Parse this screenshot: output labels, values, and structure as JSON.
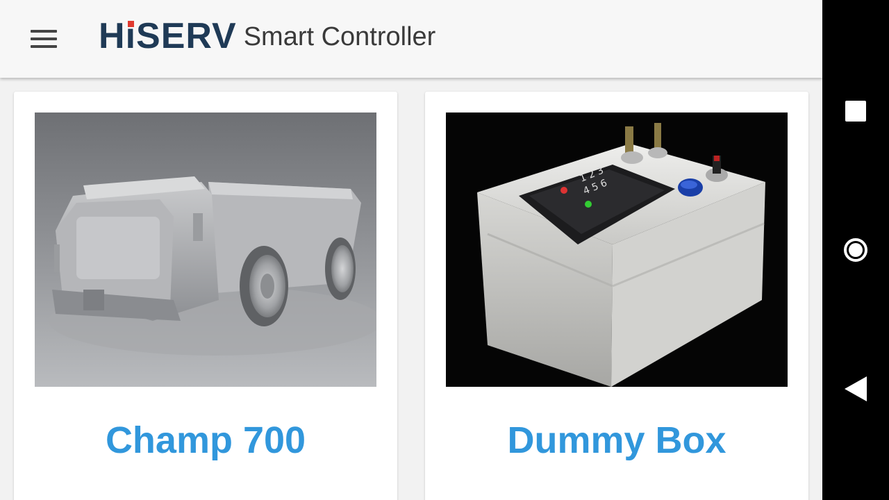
{
  "header": {
    "logo_text": "HiSERV",
    "logo_letter_h": "H",
    "logo_letter_i": "i",
    "logo_rest": "SERV",
    "title": "Smart Controller",
    "menu_icon": "hamburger-menu-icon"
  },
  "products": [
    {
      "name": "Champ 700",
      "image": "aircraft-tug-vehicle-image"
    },
    {
      "name": "Dummy Box",
      "image": "controller-box-with-keypad-image"
    }
  ],
  "navbar": {
    "icons": [
      "recents-square-icon",
      "home-circle-icon",
      "back-triangle-icon"
    ]
  },
  "colors": {
    "accent": "#3197dc",
    "logo_dark": "#1f3a56",
    "logo_dot": "#e03a2f",
    "appbar": "#f7f7f7",
    "navbar": "#000000"
  }
}
